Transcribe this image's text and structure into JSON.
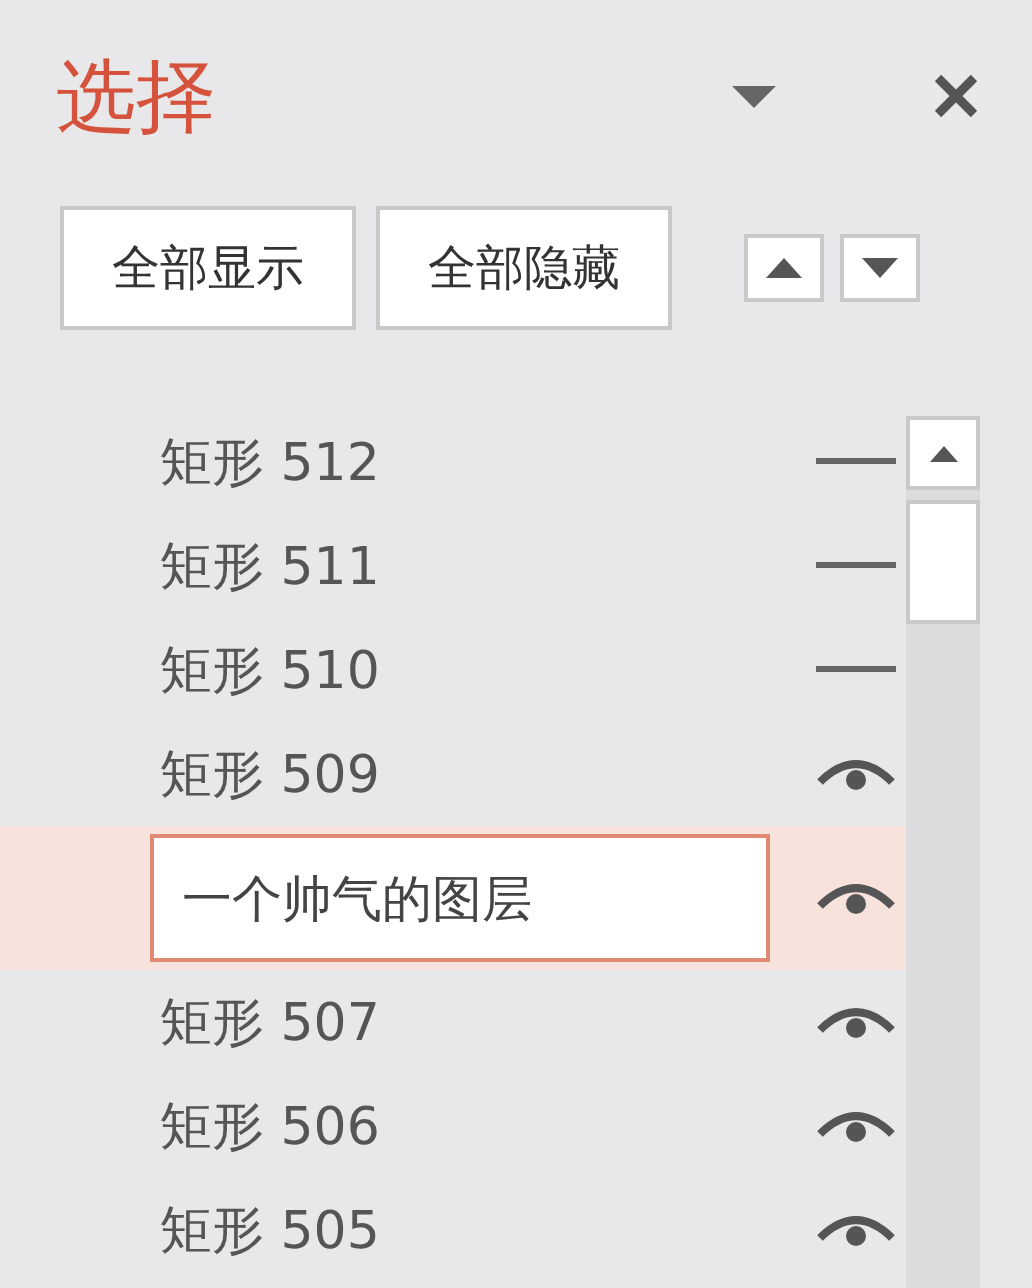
{
  "panel": {
    "title": "选择"
  },
  "buttons": [
    "全部显示",
    "全部隐藏"
  ],
  "layers": [
    {
      "name": "矩形 512",
      "visible": false,
      "selected": false,
      "editing": false
    },
    {
      "name": "矩形 511",
      "visible": false,
      "selected": false,
      "editing": false
    },
    {
      "name": "矩形 510",
      "visible": false,
      "selected": false,
      "editing": false
    },
    {
      "name": "矩形 509",
      "visible": true,
      "selected": false,
      "editing": false
    },
    {
      "name": "一个帅气的图层",
      "visible": true,
      "selected": true,
      "editing": true
    },
    {
      "name": "矩形 507",
      "visible": true,
      "selected": false,
      "editing": false
    },
    {
      "name": "矩形 506",
      "visible": true,
      "selected": false,
      "editing": false
    },
    {
      "name": "矩形 505",
      "visible": true,
      "selected": false,
      "editing": false
    }
  ]
}
